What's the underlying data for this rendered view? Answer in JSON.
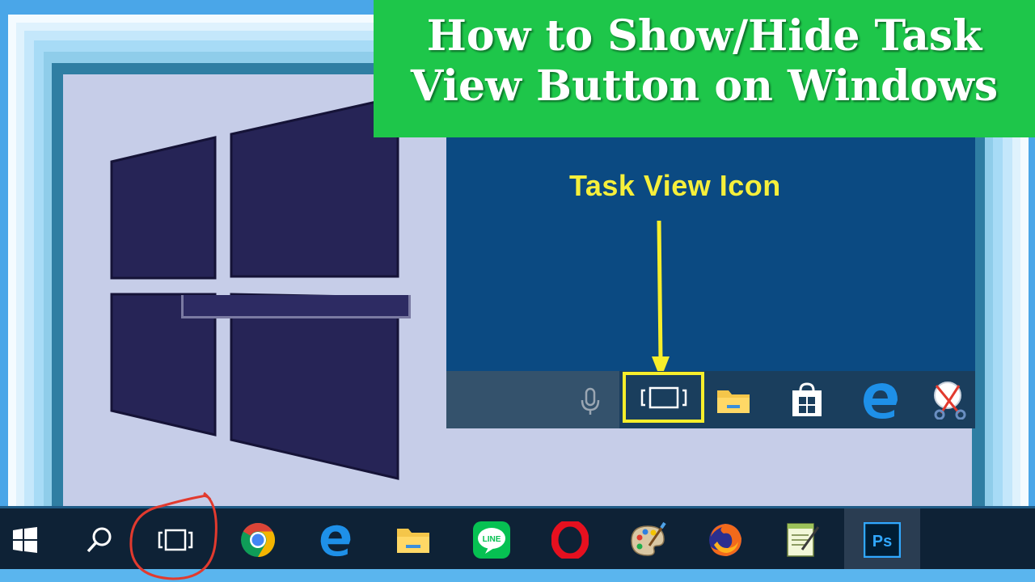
{
  "banner": {
    "line1": "How to Show/Hide Task",
    "line2": "View Button on Windows"
  },
  "inset": {
    "annotation": "Task View Icon",
    "icons": [
      "microphone-icon",
      "task-view-icon",
      "file-explorer-icon",
      "store-icon",
      "edge-icon",
      "snipping-tool-icon"
    ],
    "highlight_color": "#f7ee2b"
  },
  "taskbar": {
    "items": [
      {
        "name": "start-button",
        "icon": "windows-icon"
      },
      {
        "name": "search-button",
        "icon": "search-icon"
      },
      {
        "name": "task-view-button",
        "icon": "task-view-icon",
        "highlighted": true
      },
      {
        "name": "chrome-button",
        "icon": "chrome-icon"
      },
      {
        "name": "edge-button",
        "icon": "edge-icon"
      },
      {
        "name": "file-explorer-button",
        "icon": "folder-icon"
      },
      {
        "name": "line-button",
        "icon": "line-icon"
      },
      {
        "name": "opera-button",
        "icon": "opera-icon"
      },
      {
        "name": "paint-button",
        "icon": "palette-icon"
      },
      {
        "name": "firefox-button",
        "icon": "firefox-icon"
      },
      {
        "name": "notepad-button",
        "icon": "notepad-icon"
      },
      {
        "name": "photoshop-button",
        "icon": "photoshop-icon"
      }
    ],
    "line_label": "LINE",
    "ps_label": "Ps",
    "circle_color": "#e23a2e"
  },
  "colors": {
    "banner_green": "#1ec64a",
    "taskbar_bg": "#0e2236",
    "inset_bg": "#0b4a82",
    "logo_color": "#262456"
  }
}
